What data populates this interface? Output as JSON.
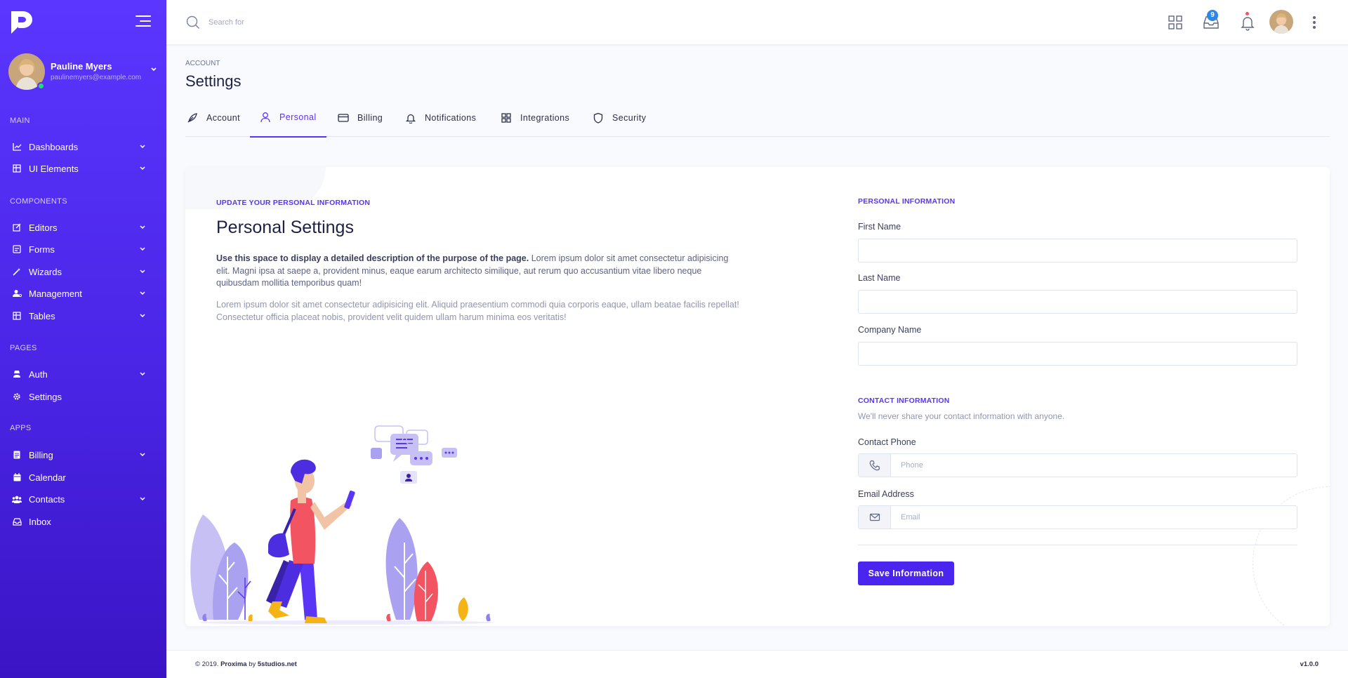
{
  "sidebar": {
    "user": {
      "name": "Pauline Myers",
      "email": "paulinemyers@example.com"
    },
    "sections": {
      "main": "MAIN",
      "components": "COMPONENTS",
      "pages": "PAGES",
      "apps": "APPS"
    },
    "items": {
      "dashboards": "Dashboards",
      "ui_elements": "UI Elements",
      "editors": "Editors",
      "forms": "Forms",
      "wizards": "Wizards",
      "management": "Management",
      "tables": "Tables",
      "auth": "Auth",
      "settings": "Settings",
      "billing": "Billing",
      "calendar": "Calendar",
      "contacts": "Contacts",
      "inbox": "Inbox"
    },
    "brand_color": "#5a36ff"
  },
  "topbar": {
    "search_placeholder": "Search for",
    "inbox_badge": "9"
  },
  "header": {
    "breadcrumb": "ACCOUNT",
    "title": "Settings"
  },
  "tabs": {
    "account": "Account",
    "personal": "Personal",
    "billing": "Billing",
    "notifications": "Notifications",
    "integrations": "Integrations",
    "security": "Security",
    "active": "Personal"
  },
  "intro": {
    "eyebrow": "UPDATE YOUR PERSONAL INFORMATION",
    "heading": "Personal Settings",
    "lead_bold": "Use this space to display a detailed description of the purpose of the page.",
    "lead_rest": " Lorem ipsum dolor sit amet consectetur adipisicing elit. Magni ipsa at saepe a, provident minus, eaque earum architecto similique, aut rerum quo accusantium vitae libero neque quibusdam mollitia temporibus quam!",
    "paragraph2": "Lorem ipsum dolor sit amet consectetur adipisicing elit. Aliquid praesentium commodi quia corporis eaque, ullam beatae facilis repellat! Consectetur officia placeat nobis, provident velit quidem ullam harum minima eos veritatis!"
  },
  "personal_form": {
    "eyebrow": "PERSONAL INFORMATION",
    "first_name_label": "First Name",
    "first_name_value": "",
    "last_name_label": "Last Name",
    "last_name_value": "",
    "company_label": "Company Name",
    "company_value": ""
  },
  "contact_form": {
    "eyebrow": "CONTACT INFORMATION",
    "subtext": "We'll never share your contact information with anyone.",
    "phone_label": "Contact Phone",
    "phone_placeholder": "Phone",
    "email_label": "Email Address",
    "email_placeholder": "Email",
    "save_label": "Save Information"
  },
  "footer": {
    "copyright": "© 2019.",
    "product": "Proxima",
    "by": "by",
    "vendor": "5studios.net",
    "version": "v1.0.0"
  },
  "colors": {
    "accent": "#5b35f5",
    "button": "#4a25f0",
    "badge": "#2d87e6",
    "online": "#2bd47d"
  }
}
